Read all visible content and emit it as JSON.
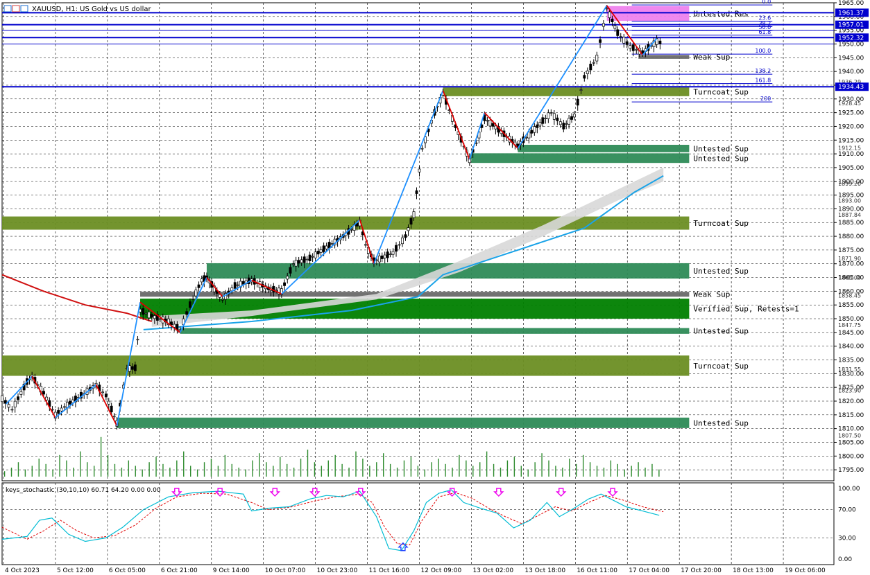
{
  "header": {
    "symbol_title": "XAUUSD, H1:  US Gold vs US dollar",
    "indicator_label": "keys_stochastic (30,10,10) 60.71 64.20 0.00 0.00"
  },
  "colors": {
    "background": "#ffffff",
    "grid": "#000000",
    "bull_candle": "#000000",
    "bear_candle": "#000000",
    "zigzag_up": "#1e90ff",
    "zigzag_down": "#e00000",
    "ma_fast": "#1aa3e8",
    "ma_slow_red": "#d01010",
    "ma_band": "#d8d8d8",
    "zone_turncoat": "#6b8e23",
    "zone_untested": "#2e8b57",
    "zone_verified": "#008000",
    "zone_weak": "#696969",
    "zone_res": "#ee82ee",
    "hline": "#0000cd",
    "volume": "#2e8b2e",
    "stoch_main": "#00bcd4",
    "stoch_signal": "#e00000",
    "stoch_arrow": "#ee00ee",
    "stoch_arrow_up": "#1e40ff"
  },
  "chart_data": {
    "type": "candlestick",
    "title": "XAUUSD, H1:  US Gold vs US dollar",
    "ylim": [
      1791,
      1965
    ],
    "price_ticks": [
      "1965.00",
      "1960.00",
      "1955.00",
      "1950.00",
      "1945.00",
      "1940.00",
      "1935.00",
      "1930.00",
      "1925.00",
      "1920.00",
      "1915.00",
      "1910.00",
      "1905.00",
      "1900.00",
      "1895.00",
      "1890.00",
      "1885.00",
      "1880.00",
      "1875.00",
      "1870.00",
      "1865.00",
      "1860.00",
      "1855.00",
      "1850.00",
      "1845.00",
      "1840.00",
      "1835.00",
      "1830.00",
      "1825.00",
      "1820.00",
      "1815.00",
      "1810.00",
      "1805.00",
      "1800.00",
      "1795.00"
    ],
    "extra_price_labels": [
      "1952.32",
      "1936.29",
      "1928.45",
      "1912.15",
      "1899.20",
      "1893.00",
      "1887.84",
      "1871.90",
      "1865.00",
      "1858.45",
      "1847.75",
      "1831.55",
      "1823.90",
      "1807.50"
    ],
    "x_labels": [
      "4 Oct 2023",
      "5 Oct 12:00",
      "6 Oct 05:00",
      "6 Oct 21:00",
      "9 Oct 14:00",
      "10 Oct 07:00",
      "10 Oct 23:00",
      "11 Oct 16:00",
      "12 Oct 09:00",
      "13 Oct 02:00",
      "13 Oct 18:00",
      "16 Oct 11:00",
      "17 Oct 04:00",
      "17 Oct 20:00",
      "18 Oct 13:00",
      "19 Oct 06:00"
    ],
    "highlighted_lines": [
      {
        "price": 1961.37,
        "label": "1961.37"
      },
      {
        "price": 1957.01,
        "label": "1957.01"
      },
      {
        "price": 1952.32,
        "label": "1952.32"
      },
      {
        "price": 1934.43,
        "label": "1934.43"
      }
    ],
    "fib_levels": [
      {
        "label": "0.0",
        "price": 1964.2
      },
      {
        "label": "23.6",
        "price": 1958.3
      },
      {
        "label": "38.2",
        "price": 1956.3
      },
      {
        "label": "50.0",
        "price": 1954.9
      },
      {
        "label": "61.8",
        "price": 1953.2
      },
      {
        "label": "100.0",
        "price": 1946.3
      },
      {
        "label": "138.2",
        "price": 1939.0
      },
      {
        "label": "161.8",
        "price": 1935.6
      },
      {
        "label": "200",
        "price": 1928.9
      }
    ],
    "zones": [
      {
        "label": "Untested Res",
        "type": "res",
        "top": 1963.8,
        "bottom": 1958.4,
        "start": 0.727
      },
      {
        "label": "Weak Sup",
        "type": "weak",
        "top": 1946.0,
        "bottom": 1944.6,
        "start": 0.765
      },
      {
        "label": "Turncoat Sup",
        "type": "turncoat",
        "top": 1934.2,
        "bottom": 1931.0,
        "start": 0.53
      },
      {
        "label": "Untested Sup",
        "type": "untested",
        "top": 1913.3,
        "bottom": 1910.6,
        "start": 0.62
      },
      {
        "label": "Untested Sup",
        "type": "untested",
        "top": 1910.2,
        "bottom": 1906.7,
        "start": 0.564
      },
      {
        "label": "Turncoat Sup",
        "type": "turncoat",
        "top": 1887.2,
        "bottom": 1882.4,
        "start": 0.0
      },
      {
        "label": "Untested Sup",
        "type": "untested",
        "top": 1870.2,
        "bottom": 1864.6,
        "start": 0.246
      },
      {
        "label": "Weak Sup",
        "type": "weak",
        "top": 1859.8,
        "bottom": 1858.0,
        "start": 0.166
      },
      {
        "label": "Verified Sup, Retests=1",
        "type": "verified",
        "top": 1857.3,
        "bottom": 1850.0,
        "start": 0.166
      },
      {
        "label": "Untested Sup",
        "type": "untested",
        "top": 1846.6,
        "bottom": 1844.5,
        "start": 0.214
      },
      {
        "label": "Turncoat Sup",
        "type": "turncoat",
        "top": 1836.6,
        "bottom": 1829.2,
        "start": 0.0
      },
      {
        "label": "Untested Sup",
        "type": "untested",
        "top": 1814.0,
        "bottom": 1810.2,
        "start": 0.138
      }
    ],
    "zigzag": [
      [
        0.005,
        1819
      ],
      [
        0.036,
        1829
      ],
      [
        0.064,
        1814
      ],
      [
        0.113,
        1826
      ],
      [
        0.138,
        1811
      ],
      [
        0.166,
        1856
      ],
      [
        0.214,
        1845
      ],
      [
        0.246,
        1865
      ],
      [
        0.265,
        1858
      ],
      [
        0.3,
        1864
      ],
      [
        0.336,
        1859
      ],
      [
        0.43,
        1886
      ],
      [
        0.447,
        1870
      ],
      [
        0.53,
        1933
      ],
      [
        0.562,
        1908
      ],
      [
        0.58,
        1925
      ],
      [
        0.62,
        1912
      ],
      [
        0.727,
        1964
      ],
      [
        0.77,
        1946
      ],
      [
        0.787,
        1952
      ]
    ],
    "candle_path": [
      [
        0.0,
        1821
      ],
      [
        0.012,
        1817
      ],
      [
        0.03,
        1827
      ],
      [
        0.036,
        1829
      ],
      [
        0.05,
        1823
      ],
      [
        0.064,
        1815
      ],
      [
        0.075,
        1818
      ],
      [
        0.095,
        1822
      ],
      [
        0.113,
        1826
      ],
      [
        0.125,
        1822
      ],
      [
        0.138,
        1812
      ],
      [
        0.15,
        1832
      ],
      [
        0.16,
        1832
      ],
      [
        0.166,
        1853
      ],
      [
        0.18,
        1851
      ],
      [
        0.2,
        1849
      ],
      [
        0.214,
        1846
      ],
      [
        0.226,
        1855
      ],
      [
        0.24,
        1864
      ],
      [
        0.246,
        1865
      ],
      [
        0.255,
        1861
      ],
      [
        0.265,
        1857
      ],
      [
        0.28,
        1862
      ],
      [
        0.3,
        1864
      ],
      [
        0.32,
        1861
      ],
      [
        0.336,
        1860
      ],
      [
        0.35,
        1870
      ],
      [
        0.37,
        1872
      ],
      [
        0.39,
        1876
      ],
      [
        0.41,
        1880
      ],
      [
        0.43,
        1885
      ],
      [
        0.437,
        1877
      ],
      [
        0.447,
        1871
      ],
      [
        0.47,
        1874
      ],
      [
        0.485,
        1880
      ],
      [
        0.495,
        1888
      ],
      [
        0.505,
        1912
      ],
      [
        0.52,
        1925
      ],
      [
        0.53,
        1932
      ],
      [
        0.545,
        1920
      ],
      [
        0.562,
        1908
      ],
      [
        0.57,
        1914
      ],
      [
        0.58,
        1923
      ],
      [
        0.6,
        1918
      ],
      [
        0.62,
        1913
      ],
      [
        0.64,
        1919
      ],
      [
        0.66,
        1925
      ],
      [
        0.675,
        1920
      ],
      [
        0.688,
        1924
      ],
      [
        0.7,
        1938
      ],
      [
        0.715,
        1945
      ],
      [
        0.727,
        1963
      ],
      [
        0.74,
        1954
      ],
      [
        0.755,
        1949
      ],
      [
        0.77,
        1947
      ],
      [
        0.787,
        1951
      ],
      [
        0.795,
        1950
      ]
    ],
    "ma_fast": [
      [
        0.17,
        1846
      ],
      [
        0.3,
        1849
      ],
      [
        0.42,
        1853
      ],
      [
        0.5,
        1858
      ],
      [
        0.53,
        1866
      ],
      [
        0.6,
        1873
      ],
      [
        0.7,
        1883
      ],
      [
        0.76,
        1896
      ],
      [
        0.795,
        1902
      ]
    ],
    "ma_red": [
      [
        0.0,
        1866
      ],
      [
        0.05,
        1860
      ],
      [
        0.1,
        1855
      ],
      [
        0.15,
        1852
      ],
      [
        0.18,
        1849
      ]
    ],
    "ma_band_upper": [
      [
        0.18,
        1851
      ],
      [
        0.3,
        1853
      ],
      [
        0.45,
        1859
      ],
      [
        0.55,
        1871
      ],
      [
        0.65,
        1884
      ],
      [
        0.74,
        1897
      ],
      [
        0.795,
        1905
      ]
    ],
    "ma_band_lower": [
      [
        0.18,
        1847
      ],
      [
        0.3,
        1851
      ],
      [
        0.45,
        1857
      ],
      [
        0.55,
        1867
      ],
      [
        0.65,
        1880
      ],
      [
        0.74,
        1893
      ],
      [
        0.795,
        1900
      ]
    ],
    "volumes": [
      3,
      5,
      8,
      4,
      6,
      10,
      7,
      4,
      12,
      9,
      5,
      14,
      8,
      6,
      22,
      12,
      7,
      5,
      9,
      6,
      4,
      8,
      11,
      7,
      5,
      9,
      14,
      6,
      4,
      8,
      10,
      6,
      12,
      7,
      5,
      4,
      9,
      13,
      8,
      6,
      11,
      7,
      5,
      10,
      15,
      8,
      6,
      9,
      12,
      7,
      5,
      14,
      10,
      6,
      8,
      13,
      7,
      5,
      9,
      11,
      6,
      4,
      8,
      10,
      7,
      5,
      12,
      9,
      6,
      8,
      14,
      7,
      5,
      9,
      11,
      6,
      4,
      8,
      13,
      9,
      6,
      5,
      10,
      7,
      12,
      8,
      6,
      5,
      9,
      7,
      4,
      6,
      8,
      5,
      7,
      4
    ],
    "stochastic": {
      "name": "keys_stochastic (30,10,10)",
      "ylim": [
        0,
        100
      ],
      "ticks": [
        "100.00",
        "70.00",
        "30.00",
        "0.00"
      ],
      "main": [
        [
          0.0,
          28
        ],
        [
          0.03,
          32
        ],
        [
          0.045,
          55
        ],
        [
          0.06,
          58
        ],
        [
          0.08,
          35
        ],
        [
          0.1,
          25
        ],
        [
          0.125,
          30
        ],
        [
          0.145,
          45
        ],
        [
          0.17,
          70
        ],
        [
          0.2,
          88
        ],
        [
          0.23,
          94
        ],
        [
          0.26,
          96
        ],
        [
          0.29,
          92
        ],
        [
          0.3,
          68
        ],
        [
          0.32,
          72
        ],
        [
          0.345,
          74
        ],
        [
          0.37,
          85
        ],
        [
          0.39,
          90
        ],
        [
          0.41,
          88
        ],
        [
          0.43,
          96
        ],
        [
          0.45,
          60
        ],
        [
          0.465,
          15
        ],
        [
          0.48,
          12
        ],
        [
          0.495,
          40
        ],
        [
          0.51,
          80
        ],
        [
          0.525,
          93
        ],
        [
          0.54,
          98
        ],
        [
          0.555,
          80
        ],
        [
          0.575,
          72
        ],
        [
          0.595,
          65
        ],
        [
          0.615,
          44
        ],
        [
          0.635,
          55
        ],
        [
          0.655,
          80
        ],
        [
          0.67,
          60
        ],
        [
          0.685,
          70
        ],
        [
          0.705,
          85
        ],
        [
          0.72,
          92
        ],
        [
          0.735,
          83
        ],
        [
          0.75,
          74
        ],
        [
          0.77,
          68
        ],
        [
          0.79,
          62
        ]
      ],
      "signal": [
        [
          0.0,
          45
        ],
        [
          0.03,
          28
        ],
        [
          0.05,
          40
        ],
        [
          0.07,
          55
        ],
        [
          0.09,
          40
        ],
        [
          0.11,
          30
        ],
        [
          0.135,
          33
        ],
        [
          0.16,
          48
        ],
        [
          0.185,
          72
        ],
        [
          0.21,
          88
        ],
        [
          0.24,
          93
        ],
        [
          0.27,
          92
        ],
        [
          0.3,
          80
        ],
        [
          0.32,
          70
        ],
        [
          0.345,
          73
        ],
        [
          0.375,
          82
        ],
        [
          0.4,
          88
        ],
        [
          0.43,
          92
        ],
        [
          0.445,
          80
        ],
        [
          0.46,
          45
        ],
        [
          0.475,
          22
        ],
        [
          0.49,
          20
        ],
        [
          0.505,
          55
        ],
        [
          0.525,
          88
        ],
        [
          0.545,
          94
        ],
        [
          0.565,
          86
        ],
        [
          0.585,
          72
        ],
        [
          0.605,
          60
        ],
        [
          0.625,
          50
        ],
        [
          0.645,
          62
        ],
        [
          0.665,
          74
        ],
        [
          0.685,
          68
        ],
        [
          0.705,
          80
        ],
        [
          0.725,
          90
        ],
        [
          0.745,
          84
        ],
        [
          0.77,
          74
        ],
        [
          0.795,
          67
        ]
      ],
      "down_arrows": [
        0.21,
        0.262,
        0.328,
        0.376,
        0.431,
        0.541,
        0.597,
        0.672,
        0.734
      ],
      "up_arrows": [
        0.482
      ]
    }
  }
}
